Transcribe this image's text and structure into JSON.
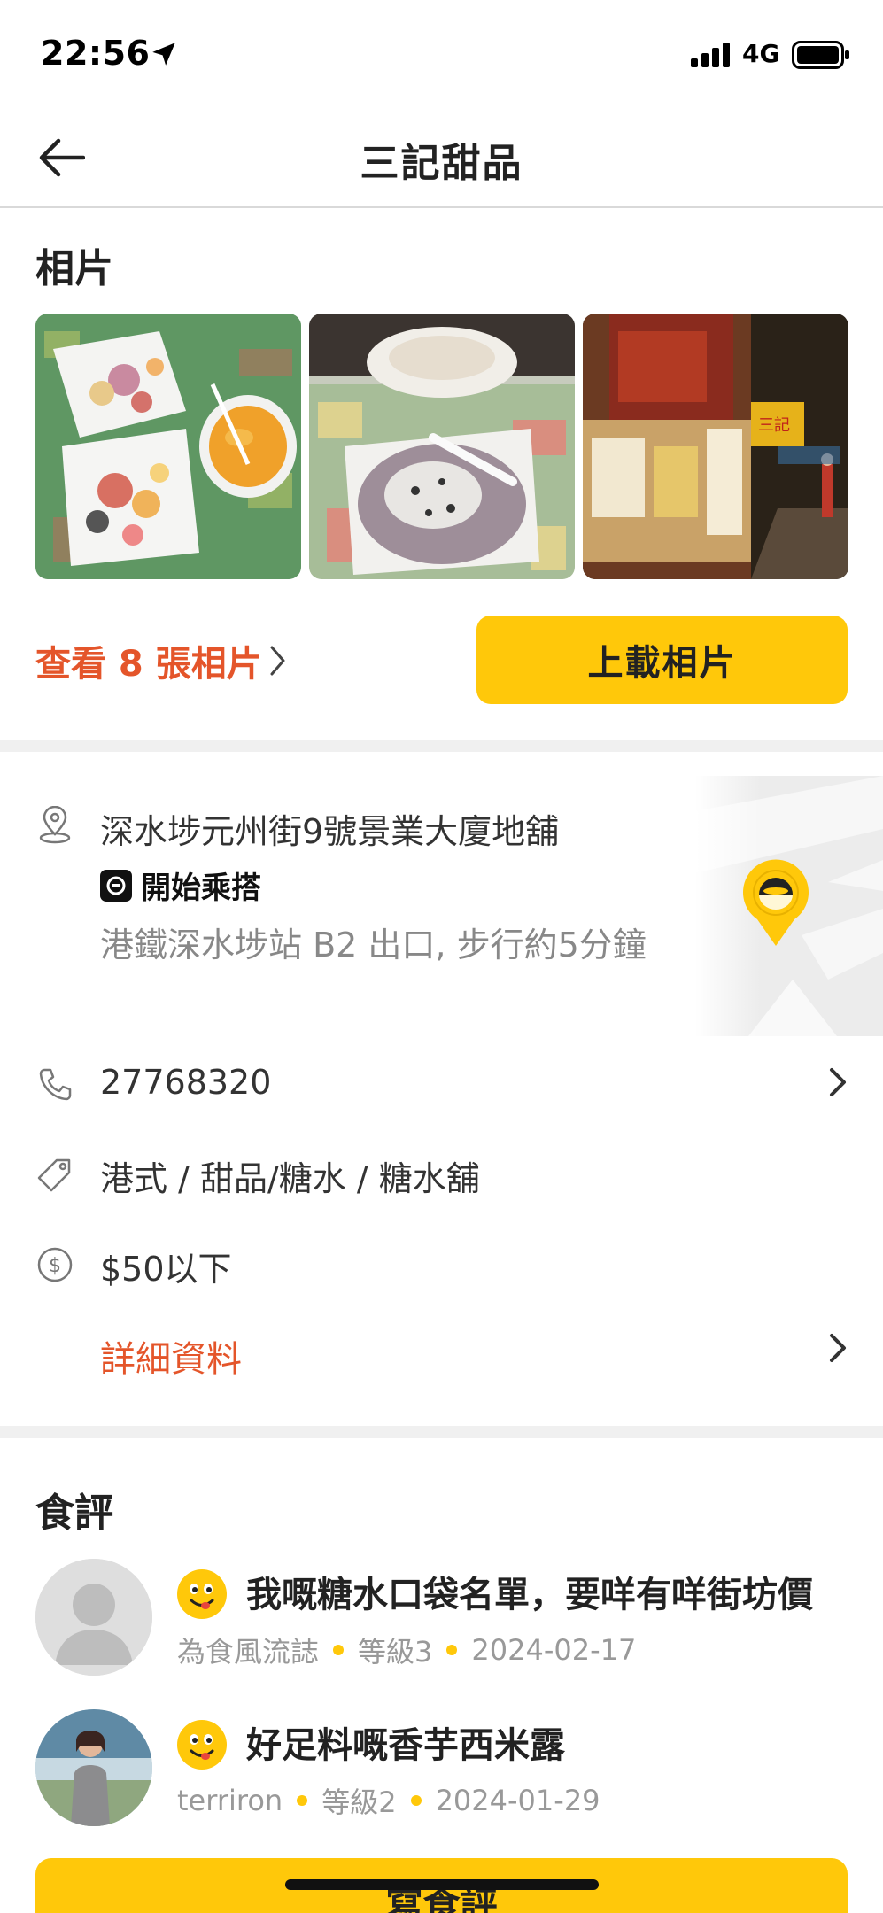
{
  "status_bar": {
    "time": "22:56",
    "network": "4G"
  },
  "header": {
    "title": "三記甜品"
  },
  "photos": {
    "section_title": "相片",
    "view_all": "查看 8 張相片",
    "upload": "上載相片"
  },
  "info": {
    "address": "深水埗元州街9號景業大廈地舖",
    "transit_label": "開始乘搭",
    "directions": "港鐵深水埗站 B2 出口, 步行約5分鐘",
    "phone": "27768320",
    "cuisine": "港式 / 甜品/糖水 / 糖水舖",
    "price": "$50以下",
    "details": "詳細資料"
  },
  "reviews": {
    "section_title": "食評",
    "items": [
      {
        "title": "我嘅糖水口袋名單，要咩有咩街坊價",
        "author": "為食風流誌",
        "level": "等級3",
        "date": "2024-02-17"
      },
      {
        "title": "好足料嘅香芋西米露",
        "author": "terriron",
        "level": "等級2",
        "date": "2024-01-29"
      }
    ],
    "write_label": "寫食評"
  },
  "colors": {
    "accent": "#ffc80a",
    "link": "#e4552a",
    "muted": "#999999"
  },
  "icons": [
    "location-arrow-icon",
    "signal-icon",
    "battery-icon",
    "back-arrow-icon",
    "chevron-right-icon",
    "map-pin-icon",
    "train-icon",
    "phone-icon",
    "tag-icon",
    "dollar-icon",
    "smiley-icon",
    "user-avatar-icon"
  ]
}
